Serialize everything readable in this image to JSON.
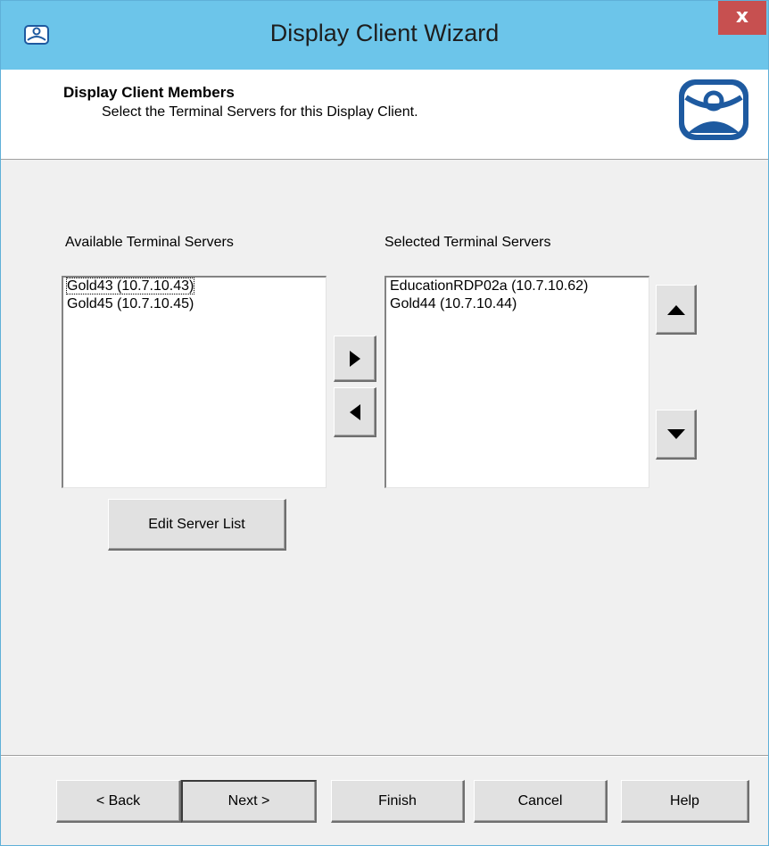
{
  "window": {
    "title": "Display Client Wizard",
    "close_label": "x"
  },
  "header": {
    "title": "Display Client Members",
    "subtitle": "Select the Terminal Servers for this Display Client."
  },
  "available": {
    "label": "Available Terminal Servers",
    "items": [
      "Gold43 (10.7.10.43)",
      "Gold45 (10.7.10.45)"
    ],
    "focused_index": 0
  },
  "selected": {
    "label": "Selected Terminal Servers",
    "items": [
      "EducationRDP02a (10.7.10.62)",
      "Gold44 (10.7.10.44)"
    ]
  },
  "buttons": {
    "edit_server_list": "Edit Server List",
    "back": "< Back",
    "next": "Next >",
    "finish": "Finish",
    "cancel": "Cancel",
    "help": "Help"
  },
  "icons": {
    "app": "thinmanager-icon",
    "logo": "thinmanager-logo",
    "add": "triangle-right-icon",
    "remove": "triangle-left-icon",
    "move_up": "triangle-up-icon",
    "move_down": "triangle-down-icon"
  },
  "colors": {
    "titlebar": "#6cc5ea",
    "close": "#c75050",
    "logo_blue": "#1e5aa0"
  }
}
